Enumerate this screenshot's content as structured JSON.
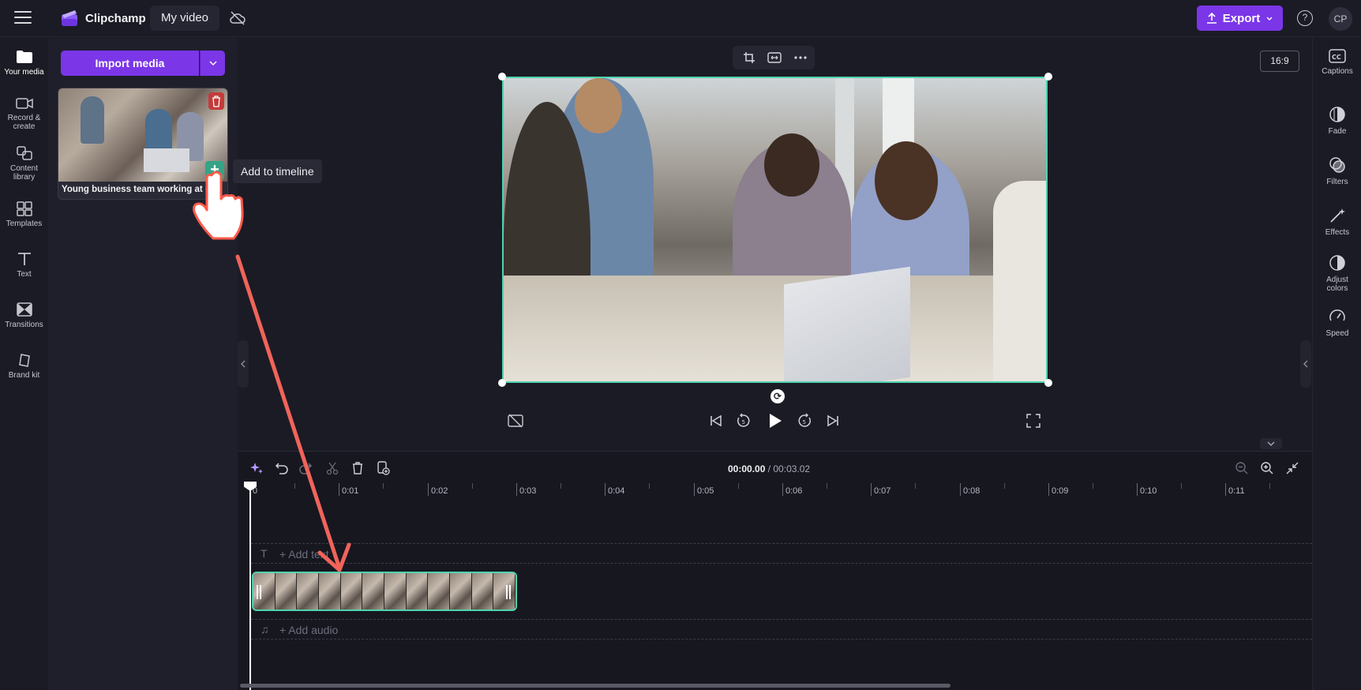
{
  "app": {
    "name": "Clipchamp",
    "video_title": "My video",
    "export_label": "Export",
    "help_icon": "?",
    "avatar_initials": "CP"
  },
  "left_nav": [
    {
      "label": "Your media",
      "icon": "folder-icon"
    },
    {
      "label": "Record & create",
      "icon": "camera-icon"
    },
    {
      "label": "Content library",
      "icon": "library-icon"
    },
    {
      "label": "Templates",
      "icon": "templates-icon"
    },
    {
      "label": "Text",
      "icon": "text-icon"
    },
    {
      "label": "Transitions",
      "icon": "transitions-icon"
    },
    {
      "label": "Brand kit",
      "icon": "brand-kit-icon"
    }
  ],
  "media": {
    "import_label": "Import media",
    "item_title": "Young business team working at o",
    "tooltip": "Add to timeline"
  },
  "preview": {
    "aspect_ratio": "16:9"
  },
  "right_nav": [
    {
      "label": "Captions",
      "icon": "captions-icon"
    },
    {
      "label": "Fade",
      "icon": "fade-icon"
    },
    {
      "label": "Filters",
      "icon": "filters-icon"
    },
    {
      "label": "Effects",
      "icon": "effects-icon"
    },
    {
      "label": "Adjust colors",
      "icon": "adjust-colors-icon"
    },
    {
      "label": "Speed",
      "icon": "speed-icon"
    }
  ],
  "timeline": {
    "current_time": "00:00.00",
    "total_time": "/ 00:03.02",
    "ruler_labels": [
      "0",
      "0:01",
      "0:02",
      "0:03",
      "0:04",
      "0:05",
      "0:06",
      "0:07",
      "0:08",
      "0:09",
      "0:10",
      "0:11"
    ],
    "text_track_label": "+ Add text",
    "audio_track_label": "+ Add audio"
  },
  "colors": {
    "accent": "#7b36e8",
    "selection": "#4fd3ae",
    "annotation": "#f0645a"
  }
}
